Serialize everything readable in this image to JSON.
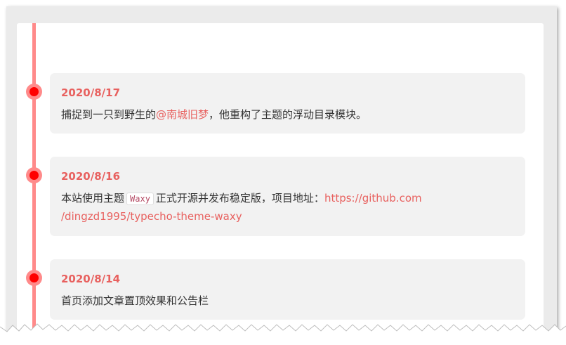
{
  "colors": {
    "accent": "#e8615f",
    "timeline": "#ff8a8a",
    "dot_core": "#ff0000",
    "entry_bg": "#f2f2f2",
    "page_bg": "#ebebeb"
  },
  "timeline": {
    "entries": [
      {
        "date": "2020/8/17",
        "text_before": "捕捉到一只到野生的",
        "link": "@南城旧梦",
        "text_after": "，他重构了主题的浮动目录模块。"
      },
      {
        "date": "2020/8/16",
        "text_before": "本站使用主题",
        "code": "Waxy",
        "text_middle": "正式开源并发布稳定版，项目地址：",
        "link_line1": "https://github.com",
        "link_line2": "/dingzd1995/typecho-theme-waxy"
      },
      {
        "date": "2020/8/14",
        "text": "首页添加文章置顶效果和公告栏"
      }
    ]
  }
}
